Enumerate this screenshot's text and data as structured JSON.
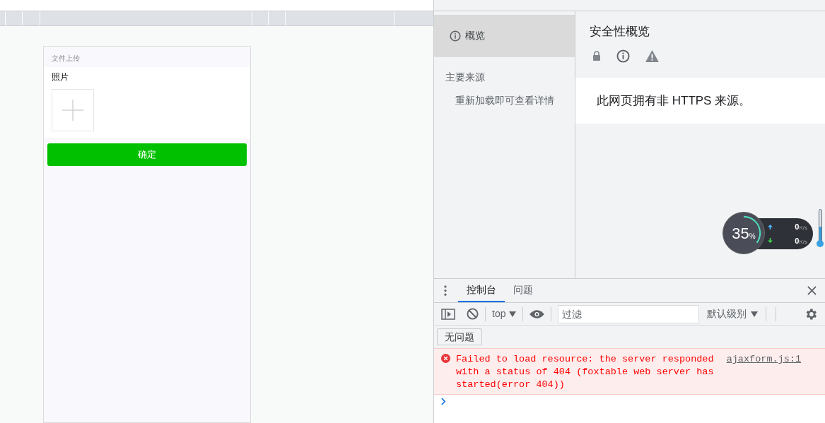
{
  "phone": {
    "header": "文件上传",
    "field_label": "照片",
    "submit": "确定"
  },
  "security": {
    "sidebar": [
      {
        "label": "概览",
        "selected": true
      }
    ],
    "section_title": "主要来源",
    "hint": "重新加载即可查看详情",
    "title": "安全性概览",
    "message": "此网页拥有非 HTTPS 来源。"
  },
  "drawer": {
    "tabs": [
      {
        "label": "控制台",
        "selected": true
      },
      {
        "label": "问题",
        "selected": false
      }
    ],
    "context": "top",
    "filter_placeholder": "过滤",
    "level_menu": "默认级别",
    "issues_button": "无问题",
    "messages": [
      {
        "kind": "error",
        "text": "Failed to load resource: the server responded with a status of 404 (foxtable web server has started(error 404))",
        "source": "ajaxform.js:1"
      }
    ]
  },
  "monitor": {
    "value": "35",
    "unit": "%",
    "level": 0.35,
    "upload": "0",
    "upload_unit": "K/s",
    "download": "0",
    "download_unit": "K/s"
  }
}
